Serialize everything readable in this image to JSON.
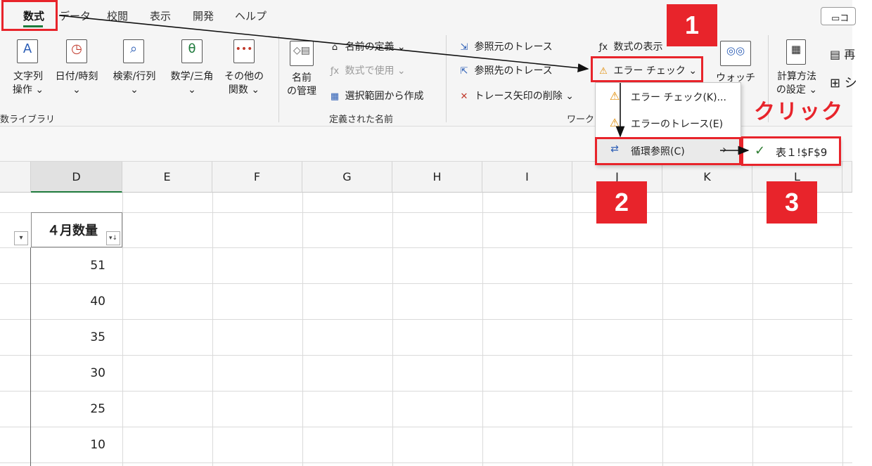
{
  "tabs": [
    "数式",
    "データ",
    "校閲",
    "表示",
    "開発",
    "ヘルプ"
  ],
  "comment_label": "コ",
  "ribbon": {
    "function_library": {
      "buttons": [
        {
          "label": "文字列\n操作 ⌄",
          "icon": "text-function-icon"
        },
        {
          "label": "日付/時刻\n⌄",
          "icon": "clock-icon"
        },
        {
          "label": "検索/行列\n⌄",
          "icon": "lookup-icon"
        },
        {
          "label": "数学/三角\n⌄",
          "icon": "math-theta-icon"
        },
        {
          "label": "その他の\n関数 ⌄",
          "icon": "more-functions-icon"
        }
      ],
      "group_label": "数ライブラリ"
    },
    "defined_names": {
      "name_manager": "名前\nの管理",
      "define_name": "名前の定義  ⌄",
      "use_in_formula": "数式で使用 ⌄",
      "create_from_selection": "選択範囲から作成",
      "group_label": "定義された名前"
    },
    "formula_auditing": {
      "trace_precedents": "参照元のトレース",
      "trace_dependents": "参照先のトレース",
      "remove_arrows": "トレース矢印の削除  ⌄",
      "show_formulas": "数式の表示",
      "error_checking": "エラー チェック  ⌄",
      "group_label": "ワーク"
    },
    "watch_window": "ウォッチ",
    "calculation": {
      "calc_options": "計算方法\nの設定 ⌄"
    }
  },
  "columns": [
    "D",
    "E",
    "F",
    "G",
    "H",
    "I",
    "J",
    "K",
    "L"
  ],
  "table": {
    "header": "４月数量",
    "values": [
      "51",
      "40",
      "35",
      "30",
      "25",
      "10"
    ]
  },
  "dropdown": {
    "items": [
      {
        "label": "エラー チェック(K)...",
        "icon": "error-check-icon"
      },
      {
        "label": "エラーのトレース(E)",
        "icon": "warning-icon"
      },
      {
        "label": "循環参照(C)",
        "icon": "circular-reference-icon"
      }
    ],
    "submenu_item": "表１!$F$9"
  },
  "annotations": {
    "step1": "1",
    "step2": "2",
    "step3": "3",
    "click_label": "クリック",
    "accent_color": "#e8242b"
  }
}
